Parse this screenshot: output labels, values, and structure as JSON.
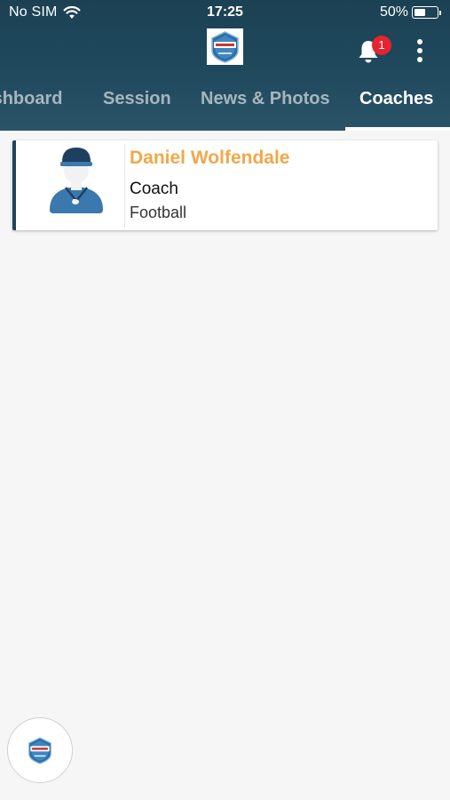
{
  "status_bar": {
    "carrier": "No SIM",
    "time": "17:25",
    "battery_percent": "50%",
    "battery_level": 0.5,
    "wifi_icon": "wifi-icon",
    "battery_icon": "battery-icon"
  },
  "header": {
    "logo_icon": "club-crest-icon",
    "notifications": {
      "icon": "bell-icon",
      "badge_count": "1"
    },
    "more_icon": "more-vertical-icon"
  },
  "tabs": [
    {
      "label": "Dashboard",
      "active": false
    },
    {
      "label": "Session",
      "active": false
    },
    {
      "label": "News & Photos",
      "active": false
    },
    {
      "label": "Coaches",
      "active": true
    }
  ],
  "coaches": [
    {
      "name": "Daniel Wolfendale",
      "role": "Coach",
      "sport": "Football",
      "avatar_icon": "coach-avatar-icon"
    }
  ],
  "fab": {
    "icon": "club-crest-icon"
  },
  "colors": {
    "header_bg": "#1b4153",
    "accent_orange": "#f0a84a",
    "badge_red": "#e6242f",
    "tab_inactive": "#a6b6bf",
    "card_border": "#1d4558",
    "page_bg": "#f6f6f6"
  }
}
